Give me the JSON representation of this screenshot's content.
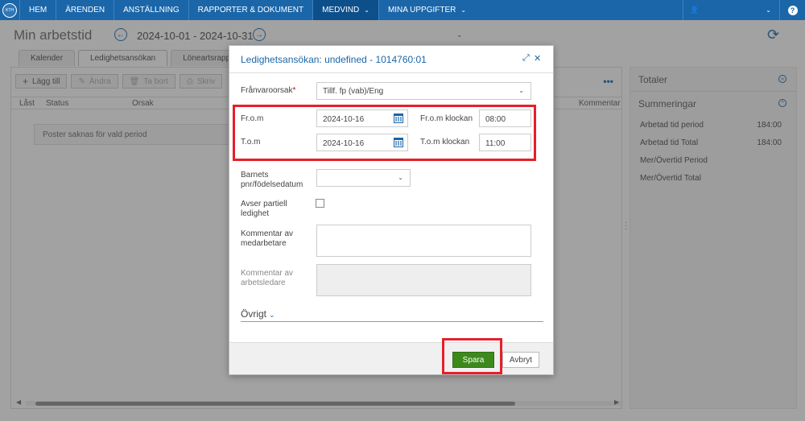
{
  "nav": {
    "items": [
      "HEM",
      "ÄRENDEN",
      "ANSTÄLLNING",
      "RAPPORTER & DOKUMENT",
      "MEDVIND",
      "MINA UPPGIFTER"
    ],
    "active": "MEDVIND",
    "logo_text": "KTH",
    "help_glyph": "?"
  },
  "header": {
    "title": "Min arbetstid",
    "period": "2024-10-01 - 2024-10-31"
  },
  "tabs": [
    "Kalender",
    "Ledighetsansökan",
    "Löneartsrapport"
  ],
  "toolbar": {
    "add": "Lägg till",
    "edit": "Ändra",
    "delete": "Ta bort",
    "sign": "Skriv"
  },
  "table": {
    "columns": [
      "Låst",
      "Status",
      "Orsak",
      "Kommentar"
    ],
    "empty": "Poster saknas för vald period"
  },
  "right_panel": {
    "totals_heading": "Totaler",
    "summary_heading": "Summeringar",
    "rows": [
      {
        "label": "Arbetad tid period",
        "value": "184:00"
      },
      {
        "label": "Arbetad tid Total",
        "value": "184:00"
      },
      {
        "label": "Mer/Övertid Period",
        "value": ""
      },
      {
        "label": "Mer/Övertid Total",
        "value": ""
      }
    ]
  },
  "modal": {
    "title": "Ledighetsansökan: undefined - 1014760:01",
    "reason_label": "Frånvaroorsak",
    "reason_required": "*",
    "reason_value": "Tillf. fp (vab)/Eng",
    "from_label": "Fr.o.m",
    "from_date": "2024-10-16",
    "from_time_label": "Fr.o.m klockan",
    "from_time": "08:00",
    "to_label": "T.o.m",
    "to_date": "2024-10-16",
    "to_time_label": "T.o.m klockan",
    "to_time": "11:00",
    "child_label_1": "Barnets",
    "child_label_2": "pnr/födelsedatum",
    "partial_label_1": "Avser partiell",
    "partial_label_2": "ledighet",
    "comment_emp_1": "Kommentar av",
    "comment_emp_2": "medarbetare",
    "comment_mgr_1": "Kommentar av",
    "comment_mgr_2": "arbetsledare",
    "ovrigt": "Övrigt",
    "save": "Spara",
    "cancel": "Avbryt"
  },
  "colors": {
    "nav_bg": "#1a66a9",
    "accent": "#1a66a9",
    "save_bg": "#3c8a1c",
    "highlight": "#e5202a"
  }
}
